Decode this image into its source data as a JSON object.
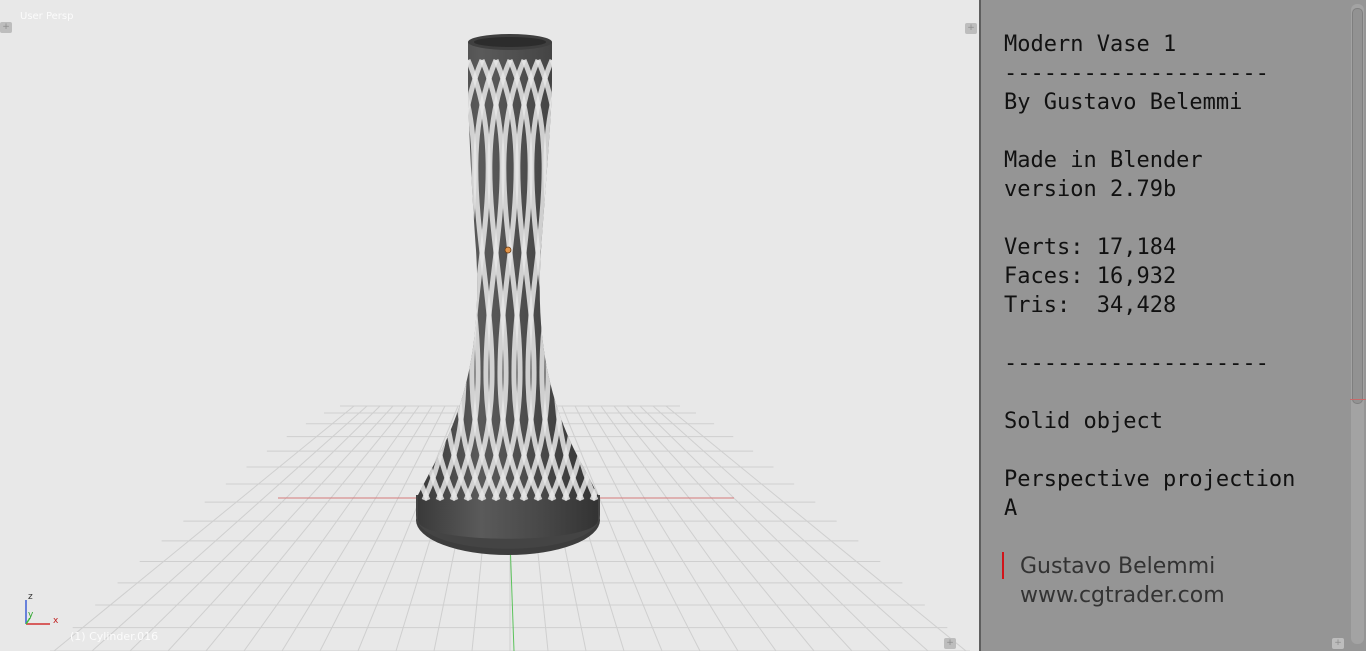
{
  "viewport": {
    "view_name": "User Persp",
    "object_label": "(1) Cylinder.016",
    "axis_labels": {
      "z": "z",
      "y": "y",
      "x": "x"
    }
  },
  "text_panel": {
    "lines": [
      "Modern Vase 1",
      "--------------------",
      "By Gustavo Belemmi",
      "",
      "Made in Blender",
      "version 2.79b",
      "",
      "Verts: 17,184",
      "Faces: 16,932",
      "Tris:  34,428",
      "",
      "--------------------",
      "",
      "Solid object",
      "",
      "Perspective projection",
      "A"
    ],
    "signature_name": "Gustavo Belemmi",
    "signature_site": "www.cgtrader.com"
  },
  "colors": {
    "viewport_bg": "#e8e8e8",
    "panel_bg": "#959595",
    "grid_line": "#cfcfcf",
    "x_axis": "#d47a7a",
    "y_axis": "#5cc35c",
    "vase": "#4a4a4a",
    "accent_red": "#d1141a"
  },
  "icons": [
    "corner-handle-icon",
    "axis-gizmo-icon",
    "origin-dot-icon"
  ]
}
